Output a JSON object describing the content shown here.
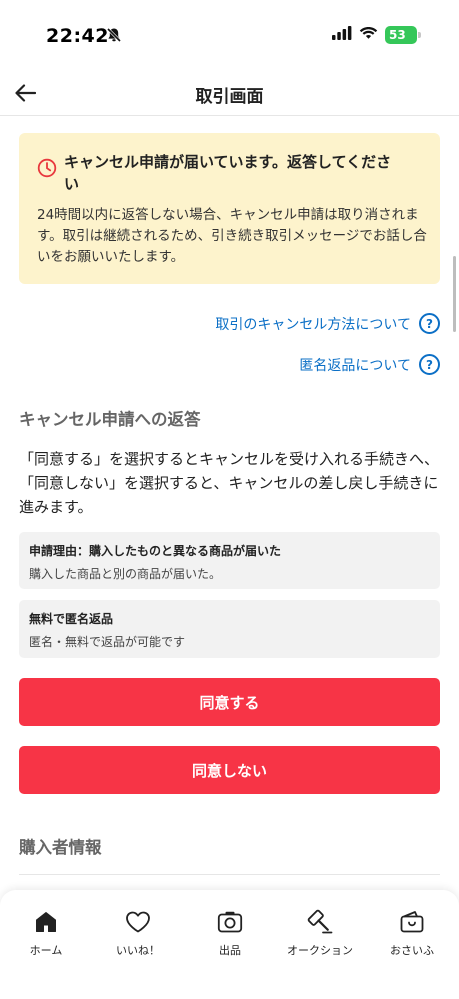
{
  "status_bar": {
    "time": "22:42",
    "battery": "53"
  },
  "nav": {
    "title": "取引画面"
  },
  "notice": {
    "title": "キャンセル申請が届いています。返答してください",
    "body": "24時間以内に返答しない場合、キャンセル申請は取り消されます。取引は継続されるため、引き続き取引メッセージでお話し合いをお願いいたします。"
  },
  "links": {
    "cancel_method": "取引のキャンセル方法について",
    "anonymous_return": "匿名返品について",
    "help_glyph": "?"
  },
  "response": {
    "heading": "キャンセル申請への返答",
    "explanation": "「同意する」を選択するとキャンセルを受け入れる手続きへ、「同意しない」を選択すると、キャンセルの差し戻し手続きに進みます。",
    "reason_title": "申請理由：購入したものと異なる商品が届いた",
    "reason_detail": "購入した商品と別の商品が届いた。",
    "return_title": "無料で匿名返品",
    "return_detail": "匿名・無料で返品が可能です",
    "agree_label": "同意する",
    "disagree_label": "同意しない"
  },
  "buyer": {
    "heading": "購入者情報"
  },
  "tab_bar": {
    "items": [
      {
        "label": "ホーム",
        "icon": "home-icon"
      },
      {
        "label": "いいね！",
        "icon": "heart-icon"
      },
      {
        "label": "出品",
        "icon": "camera-icon"
      },
      {
        "label": "オークション",
        "icon": "gavel-icon"
      },
      {
        "label": "おさいふ",
        "icon": "wallet-icon"
      }
    ]
  },
  "colors": {
    "accent_red": "#f73446",
    "link_blue": "#0b6fc6",
    "notice_bg": "#fdf3cc"
  }
}
